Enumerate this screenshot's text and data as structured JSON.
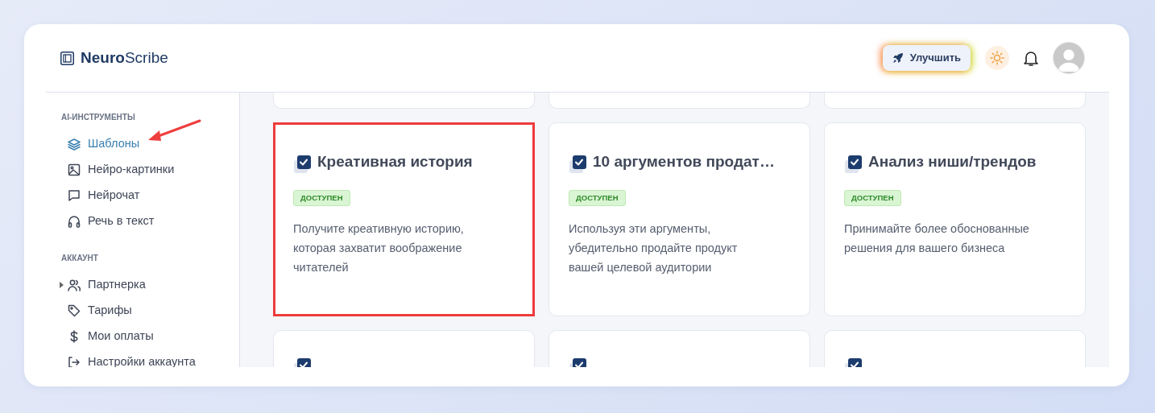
{
  "header": {
    "logo": "**Neuro**Scribe",
    "upgrade_button": "Улучшить"
  },
  "sidebar": {
    "sections": [
      {
        "title": "AI-ИНСТРУМЕНТЫ",
        "items": [
          {
            "label": "Шаблоны",
            "selected": true
          },
          {
            "label": "Нейро-картинки",
            "selected": false
          },
          {
            "label": "Нейрочат",
            "selected": false
          },
          {
            "label": "Речь в текст",
            "selected": false
          }
        ]
      },
      {
        "title": "АККАУНТ",
        "items": [
          {
            "label": "Партнерка",
            "selected": false,
            "expanded": false
          },
          {
            "label": "Тарифы",
            "selected": false
          },
          {
            "label": "Мои оплаты",
            "selected": false
          },
          {
            "label": "Настройки аккаунта",
            "selected": false
          }
        ]
      }
    ]
  },
  "cards": [
    {
      "title": "Креативная история",
      "badge": "ДОСТУПЕН",
      "description": "Получите креативную историю, которая захватит воображение читателей",
      "highlighted": true
    },
    {
      "title": "10 аргументов продат…",
      "badge": "ДОСТУПЕН",
      "description": "Используя эти аргументы, убедительно продайте продукт вашей целевой аудитории",
      "highlighted": false
    },
    {
      "title": "Анализ ниши/трендов",
      "badge": "ДОСТУПЕН",
      "description": "Принимайте более обоснованные решения для вашего бизнеса",
      "highlighted": false
    }
  ]
}
